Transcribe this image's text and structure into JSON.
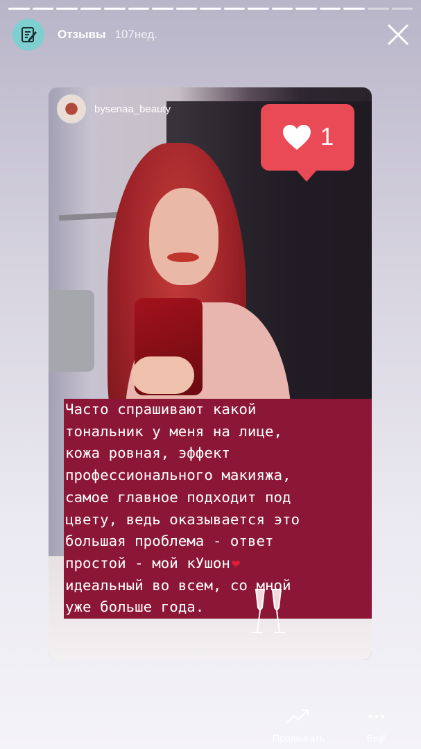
{
  "story": {
    "progress_segments": 17,
    "completed_segments": 15
  },
  "header": {
    "title": "Отзывы",
    "age": "107нед.",
    "avatar_icon": "notebook-pen-icon",
    "close_icon": "close-icon"
  },
  "post": {
    "username": "bysenaa_beauty",
    "likes_count": "1",
    "caption_lines": [
      "Часто спрашивают какой",
      "тональник у меня на лице,",
      "кожа ровная, эффект",
      "профессионального макияжа,",
      "самое главное подходит под",
      "цвету, ведь оказывается это",
      "большая проблема - ответ",
      "простой - мой кУшон",
      "идеальный во всем, со мной",
      "уже больше года."
    ]
  },
  "actions": {
    "promote_label": "Продвигать",
    "more_label": "Ещё"
  },
  "colors": {
    "caption_bg": "#8c1636",
    "likes_bg": "#ea4a55",
    "avatar_bg": "#7ecfcf"
  }
}
